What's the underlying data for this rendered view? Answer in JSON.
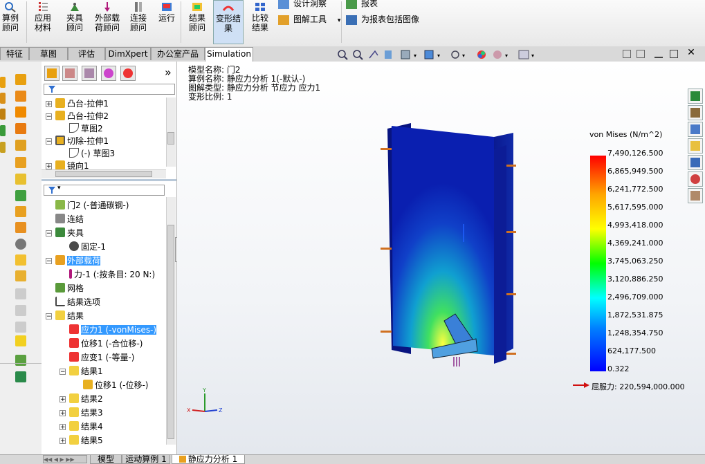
{
  "ribbon": {
    "study_advisor": "算例顾问",
    "apply_material": "应用材料",
    "fixtures_advisor": "夹具顾问",
    "external_loads_advisor": "外部载荷顾问",
    "connections_advisor": "连接顾问",
    "run": "运行",
    "results_advisor": "结果顾问",
    "deformed_result": "变形结果",
    "compare_results": "比较结果",
    "design_insight": "设计洞察",
    "plot_tools": "图解工具",
    "report": "报表",
    "include_image": "为报表包括图像"
  },
  "tabs": [
    "特征",
    "草图",
    "评估",
    "DimXpert",
    "办公室产品",
    "Simulation"
  ],
  "tree_top": [
    {
      "label": "凸台-拉伸1"
    },
    {
      "label": "凸台-拉伸2"
    },
    {
      "label": "草图2"
    },
    {
      "label": "切除-拉伸1"
    },
    {
      "label": "(-) 草图3"
    },
    {
      "label": "镜向1"
    }
  ],
  "tree_sim": [
    {
      "label": "门2 (-普通碳钢-)"
    },
    {
      "label": "连结"
    },
    {
      "label": "夹具"
    },
    {
      "label": "固定-1"
    },
    {
      "label": "外部载荷"
    },
    {
      "label": "力-1 (:按条目: 20 N:)"
    },
    {
      "label": "网格"
    },
    {
      "label": "结果选项"
    },
    {
      "label": "结果"
    },
    {
      "label": "应力1 (-vonMises-)"
    },
    {
      "label": "位移1 (-合位移-)"
    },
    {
      "label": "应变1 (-等量-)"
    },
    {
      "label": "结果1"
    },
    {
      "label": "位移1 (-位移-)"
    },
    {
      "label": "结果2"
    },
    {
      "label": "结果3"
    },
    {
      "label": "结果4"
    },
    {
      "label": "结果5"
    }
  ],
  "viewport": {
    "model_name": "模型名称: 门2",
    "study_name": "算例名称: 静应力分析 1(-默认-)",
    "plot_type": "图解类型: 静应力分析 节应力 应力1",
    "deform_scale": "变形比例: 1"
  },
  "legend": {
    "title": "von Mises (N/m^2)",
    "ticks": [
      "7,490,126.500",
      "6,865,949.500",
      "6,241,772.500",
      "5,617,595.000",
      "4,993,418.000",
      "4,369,241.000",
      "3,745,063.250",
      "3,120,886.250",
      "2,496,709.000",
      "1,872,531.875",
      "1,248,354.750",
      "624,177.500",
      "0.322"
    ],
    "yield": "屈服力: 220,594,000.000",
    "colors": [
      "#ff0000",
      "#ffa500",
      "#ffff00",
      "#00ff00",
      "#00ffff",
      "#0000ff"
    ]
  },
  "triad": {
    "x": "X",
    "y": "Y",
    "z": "Z"
  },
  "bottom_tabs": [
    "模型",
    "运动算例 1",
    "静应力分析 1"
  ],
  "fm_expand_label": "»"
}
